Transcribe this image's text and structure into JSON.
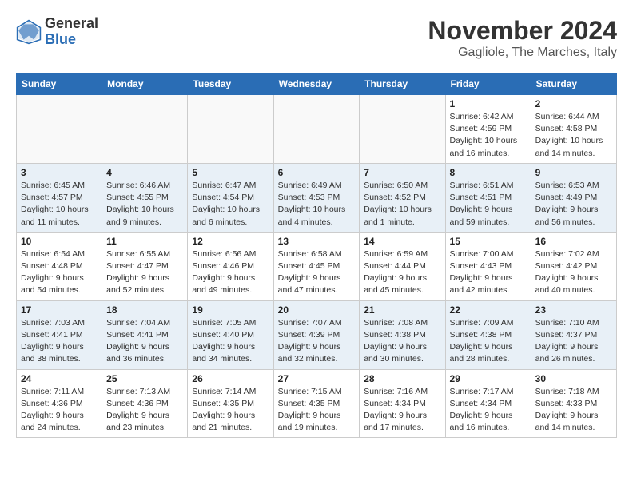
{
  "header": {
    "logo_general": "General",
    "logo_blue": "Blue",
    "month_title": "November 2024",
    "location": "Gagliole, The Marches, Italy"
  },
  "days_of_week": [
    "Sunday",
    "Monday",
    "Tuesday",
    "Wednesday",
    "Thursday",
    "Friday",
    "Saturday"
  ],
  "weeks": [
    [
      {
        "day": "",
        "info": ""
      },
      {
        "day": "",
        "info": ""
      },
      {
        "day": "",
        "info": ""
      },
      {
        "day": "",
        "info": ""
      },
      {
        "day": "",
        "info": ""
      },
      {
        "day": "1",
        "info": "Sunrise: 6:42 AM\nSunset: 4:59 PM\nDaylight: 10 hours and 16 minutes."
      },
      {
        "day": "2",
        "info": "Sunrise: 6:44 AM\nSunset: 4:58 PM\nDaylight: 10 hours and 14 minutes."
      }
    ],
    [
      {
        "day": "3",
        "info": "Sunrise: 6:45 AM\nSunset: 4:57 PM\nDaylight: 10 hours and 11 minutes."
      },
      {
        "day": "4",
        "info": "Sunrise: 6:46 AM\nSunset: 4:55 PM\nDaylight: 10 hours and 9 minutes."
      },
      {
        "day": "5",
        "info": "Sunrise: 6:47 AM\nSunset: 4:54 PM\nDaylight: 10 hours and 6 minutes."
      },
      {
        "day": "6",
        "info": "Sunrise: 6:49 AM\nSunset: 4:53 PM\nDaylight: 10 hours and 4 minutes."
      },
      {
        "day": "7",
        "info": "Sunrise: 6:50 AM\nSunset: 4:52 PM\nDaylight: 10 hours and 1 minute."
      },
      {
        "day": "8",
        "info": "Sunrise: 6:51 AM\nSunset: 4:51 PM\nDaylight: 9 hours and 59 minutes."
      },
      {
        "day": "9",
        "info": "Sunrise: 6:53 AM\nSunset: 4:49 PM\nDaylight: 9 hours and 56 minutes."
      }
    ],
    [
      {
        "day": "10",
        "info": "Sunrise: 6:54 AM\nSunset: 4:48 PM\nDaylight: 9 hours and 54 minutes."
      },
      {
        "day": "11",
        "info": "Sunrise: 6:55 AM\nSunset: 4:47 PM\nDaylight: 9 hours and 52 minutes."
      },
      {
        "day": "12",
        "info": "Sunrise: 6:56 AM\nSunset: 4:46 PM\nDaylight: 9 hours and 49 minutes."
      },
      {
        "day": "13",
        "info": "Sunrise: 6:58 AM\nSunset: 4:45 PM\nDaylight: 9 hours and 47 minutes."
      },
      {
        "day": "14",
        "info": "Sunrise: 6:59 AM\nSunset: 4:44 PM\nDaylight: 9 hours and 45 minutes."
      },
      {
        "day": "15",
        "info": "Sunrise: 7:00 AM\nSunset: 4:43 PM\nDaylight: 9 hours and 42 minutes."
      },
      {
        "day": "16",
        "info": "Sunrise: 7:02 AM\nSunset: 4:42 PM\nDaylight: 9 hours and 40 minutes."
      }
    ],
    [
      {
        "day": "17",
        "info": "Sunrise: 7:03 AM\nSunset: 4:41 PM\nDaylight: 9 hours and 38 minutes."
      },
      {
        "day": "18",
        "info": "Sunrise: 7:04 AM\nSunset: 4:41 PM\nDaylight: 9 hours and 36 minutes."
      },
      {
        "day": "19",
        "info": "Sunrise: 7:05 AM\nSunset: 4:40 PM\nDaylight: 9 hours and 34 minutes."
      },
      {
        "day": "20",
        "info": "Sunrise: 7:07 AM\nSunset: 4:39 PM\nDaylight: 9 hours and 32 minutes."
      },
      {
        "day": "21",
        "info": "Sunrise: 7:08 AM\nSunset: 4:38 PM\nDaylight: 9 hours and 30 minutes."
      },
      {
        "day": "22",
        "info": "Sunrise: 7:09 AM\nSunset: 4:38 PM\nDaylight: 9 hours and 28 minutes."
      },
      {
        "day": "23",
        "info": "Sunrise: 7:10 AM\nSunset: 4:37 PM\nDaylight: 9 hours and 26 minutes."
      }
    ],
    [
      {
        "day": "24",
        "info": "Sunrise: 7:11 AM\nSunset: 4:36 PM\nDaylight: 9 hours and 24 minutes."
      },
      {
        "day": "25",
        "info": "Sunrise: 7:13 AM\nSunset: 4:36 PM\nDaylight: 9 hours and 23 minutes."
      },
      {
        "day": "26",
        "info": "Sunrise: 7:14 AM\nSunset: 4:35 PM\nDaylight: 9 hours and 21 minutes."
      },
      {
        "day": "27",
        "info": "Sunrise: 7:15 AM\nSunset: 4:35 PM\nDaylight: 9 hours and 19 minutes."
      },
      {
        "day": "28",
        "info": "Sunrise: 7:16 AM\nSunset: 4:34 PM\nDaylight: 9 hours and 17 minutes."
      },
      {
        "day": "29",
        "info": "Sunrise: 7:17 AM\nSunset: 4:34 PM\nDaylight: 9 hours and 16 minutes."
      },
      {
        "day": "30",
        "info": "Sunrise: 7:18 AM\nSunset: 4:33 PM\nDaylight: 9 hours and 14 minutes."
      }
    ]
  ]
}
